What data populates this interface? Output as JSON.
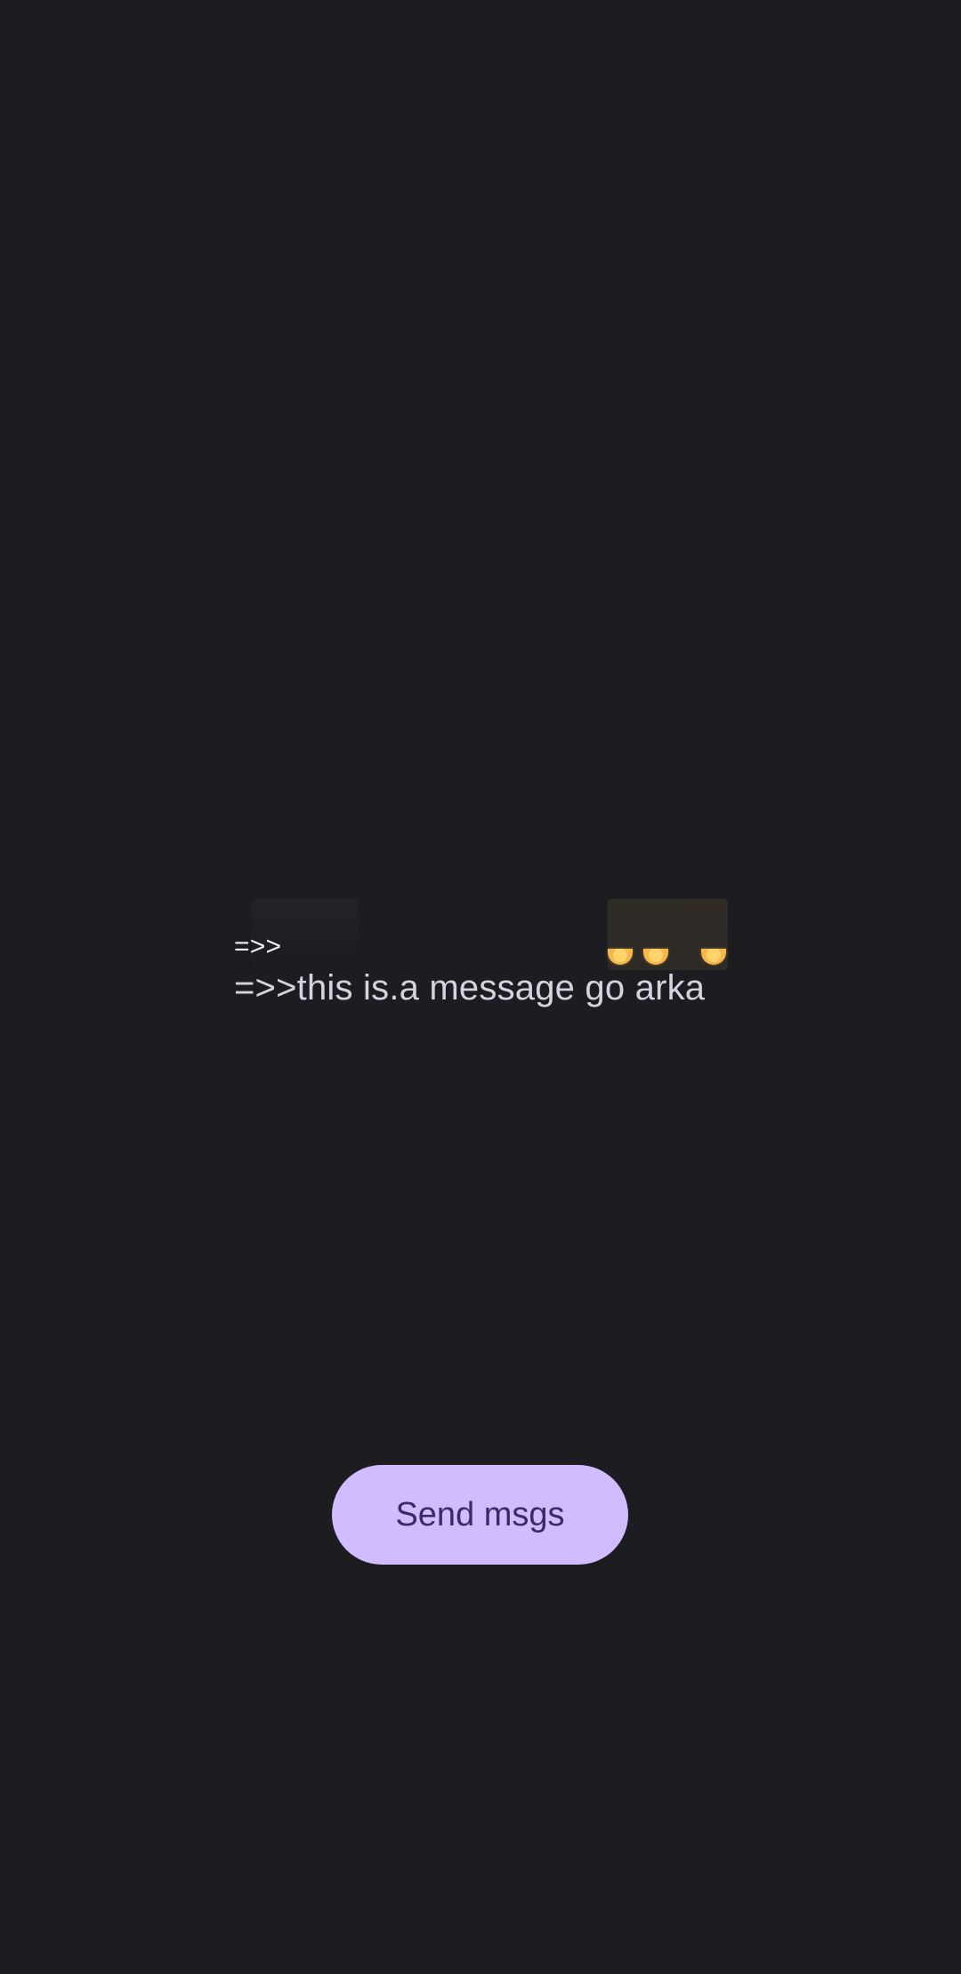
{
  "messages": {
    "line_1": "=>>",
    "line_2": "=>>this is.a message go arka"
  },
  "send_button": {
    "label": "Send msgs"
  },
  "colors": {
    "background": "#1d1c21",
    "button_background": "#d0bcfe",
    "button_text": "#3b2a6b",
    "message_text": "#d7d2de"
  }
}
